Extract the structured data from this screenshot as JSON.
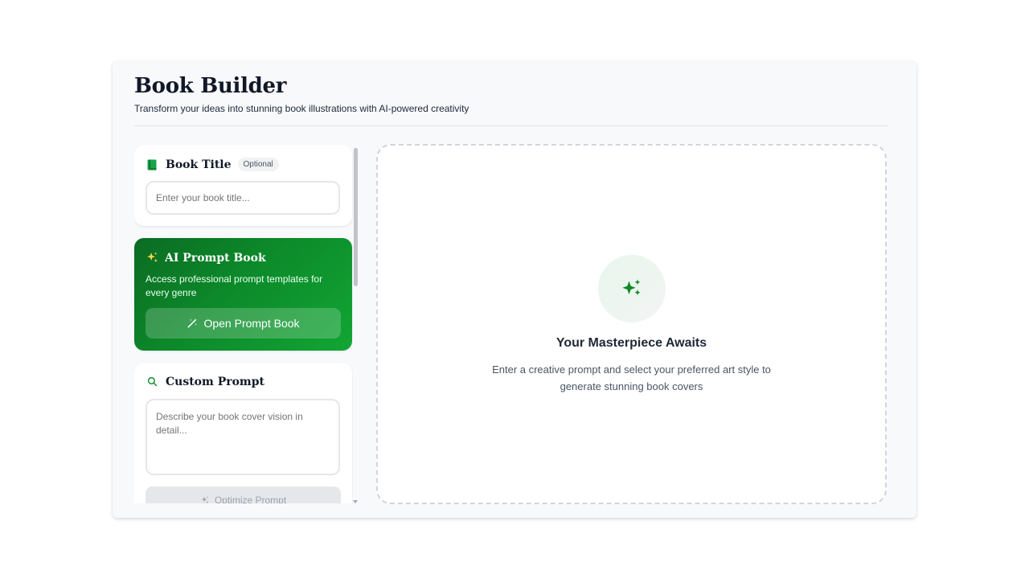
{
  "app": {
    "title": "Book Builder",
    "subtitle": "Transform your ideas into stunning book illustrations with AI-powered creativity"
  },
  "book_title_card": {
    "icon": "book-icon",
    "title": "Book Title",
    "badge": "Optional",
    "input_placeholder": "Enter your book title...",
    "input_value": ""
  },
  "prompt_book_card": {
    "icon": "sparkles-icon",
    "title": "AI Prompt Book",
    "description": "Access professional prompt templates for every genre",
    "button_icon": "magic-wand-icon",
    "button_label": "Open Prompt Book"
  },
  "custom_prompt_card": {
    "icon": "search-icon",
    "title": "Custom Prompt",
    "textarea_placeholder": "Describe your book cover vision in detail...",
    "textarea_value": "",
    "optimize_icon": "sparkles-icon",
    "optimize_label": "Optimize Prompt"
  },
  "preview": {
    "icon": "sparkles-icon",
    "title": "Your Masterpiece Awaits",
    "description": "Enter a creative prompt and select your preferred art style to generate stunning book covers"
  },
  "colors": {
    "accent_green": "#0c8a2a",
    "accent_yellow": "#ffd84a",
    "text_dark": "#111827"
  }
}
